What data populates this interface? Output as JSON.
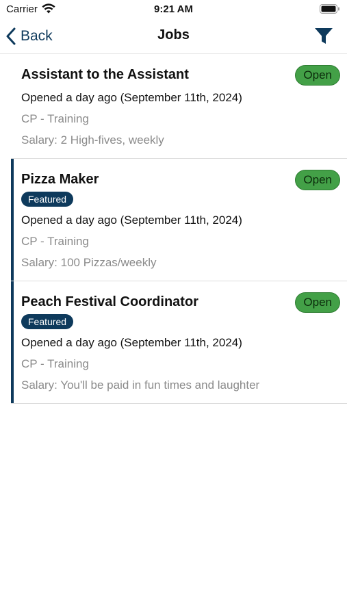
{
  "status_bar": {
    "carrier": "Carrier",
    "time": "9:21 AM"
  },
  "nav": {
    "back_label": "Back",
    "title": "Jobs",
    "filter_icon": "filter-icon"
  },
  "colors": {
    "accent": "#0e3a5c",
    "open_status": "#43a047"
  },
  "jobs": [
    {
      "title": "Assistant to the Assistant",
      "status": "Open",
      "featured": false,
      "opened": "Opened a day ago (September 11th, 2024)",
      "department": "CP - Training",
      "salary": "Salary: 2 High-fives, weekly"
    },
    {
      "title": "Pizza Maker",
      "status": "Open",
      "featured": true,
      "featured_label": "Featured",
      "opened": "Opened a day ago (September 11th, 2024)",
      "department": "CP - Training",
      "salary": "Salary: 100 Pizzas/weekly"
    },
    {
      "title": "Peach Festival Coordinator",
      "status": "Open",
      "featured": true,
      "featured_label": "Featured",
      "opened": "Opened a day ago (September 11th, 2024)",
      "department": "CP - Training",
      "salary": "Salary: You'll be paid in fun times and laughter"
    }
  ]
}
